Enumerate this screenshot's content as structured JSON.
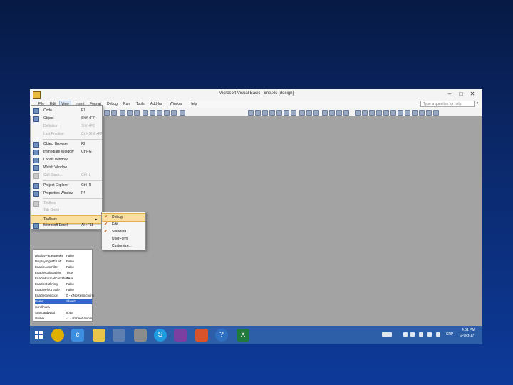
{
  "window": {
    "title": "Microsoft Visual Basic - ime.xls [design]"
  },
  "help_box": {
    "placeholder": "Type a question for help"
  },
  "menubar": {
    "items": [
      "File",
      "Edit",
      "View",
      "Insert",
      "Format",
      "Debug",
      "Run",
      "Tools",
      "Add-Ins",
      "Window",
      "Help"
    ],
    "open_item": "View"
  },
  "view_menu": {
    "items": [
      {
        "label": "Code",
        "shortcut": "F7",
        "icon": "code-icon",
        "enabled": true
      },
      {
        "label": "Object",
        "shortcut": "Shift+F7",
        "icon": "object-icon",
        "enabled": true
      },
      {
        "label": "Definition",
        "shortcut": "Shift+F2",
        "icon": "",
        "enabled": false
      },
      {
        "label": "Last Position",
        "shortcut": "Ctrl+Shift+F2",
        "icon": "",
        "enabled": false
      },
      {
        "label": "Object Browser",
        "shortcut": "F2",
        "icon": "object-browser-icon",
        "enabled": true
      },
      {
        "label": "Immediate Window",
        "shortcut": "Ctrl+G",
        "icon": "immediate-window-icon",
        "enabled": true
      },
      {
        "label": "Locals Window",
        "shortcut": "",
        "icon": "locals-window-icon",
        "enabled": true
      },
      {
        "label": "Watch Window",
        "shortcut": "",
        "icon": "watch-window-icon",
        "enabled": true
      },
      {
        "label": "Call Stack...",
        "shortcut": "Ctrl+L",
        "icon": "call-stack-icon",
        "enabled": false
      },
      {
        "label": "Project Explorer",
        "shortcut": "Ctrl+R",
        "icon": "project-explorer-icon",
        "enabled": true
      },
      {
        "label": "Properties Window",
        "shortcut": "F4",
        "icon": "properties-window-icon",
        "enabled": true
      },
      {
        "label": "Toolbox",
        "shortcut": "",
        "icon": "toolbox-icon",
        "enabled": false
      },
      {
        "label": "Tab Order",
        "shortcut": "",
        "icon": "",
        "enabled": false
      },
      {
        "label": "Toolbars",
        "shortcut": "▸",
        "icon": "",
        "enabled": true,
        "highlighted": true
      },
      {
        "label": "Microsoft Excel",
        "shortcut": "Alt+F11",
        "icon": "excel-icon",
        "enabled": true
      }
    ]
  },
  "toolbars_submenu": {
    "items": [
      {
        "label": "Debug",
        "checked": true,
        "highlighted": true
      },
      {
        "label": "Edit",
        "checked": true
      },
      {
        "label": "Standard",
        "checked": true
      },
      {
        "label": "UserForm",
        "checked": false
      },
      {
        "label": "Customize...",
        "checked": false
      }
    ]
  },
  "properties": {
    "rows": [
      {
        "name": "DisplayPageBreaks",
        "value": "False"
      },
      {
        "name": "DisplayRightToLeft",
        "value": "False"
      },
      {
        "name": "EnableAutoFilter",
        "value": "False"
      },
      {
        "name": "EnableCalculation",
        "value": "True"
      },
      {
        "name": "EnableFormatConditions",
        "value": "True"
      },
      {
        "name": "EnableOutlining",
        "value": "False"
      },
      {
        "name": "EnablePivotTable",
        "value": "False"
      },
      {
        "name": "EnableSelection",
        "value": "0 - xlNoRestrictions"
      },
      {
        "name": "Name",
        "value": "Sheet1",
        "selected": true
      },
      {
        "name": "ScrollArea",
        "value": ""
      },
      {
        "name": "StandardWidth",
        "value": "8.43"
      },
      {
        "name": "Visible",
        "value": "-1 - xlSheetVisible"
      }
    ]
  },
  "taskbar": {
    "apps": [
      "chrome-icon",
      "ie-icon",
      "file-explorer-icon",
      "vb-icon",
      "calculator-icon",
      "skype-icon",
      "save-icon",
      "powerpoint-icon",
      "help-icon",
      "excel-icon"
    ],
    "lang": "SRP",
    "time": "4:31 PM",
    "date": "2-Oct-17"
  },
  "colors": {
    "taskbar": "#2c5fa8",
    "highlight": "#f9e0a0",
    "desktop": "#0b2a6e"
  }
}
